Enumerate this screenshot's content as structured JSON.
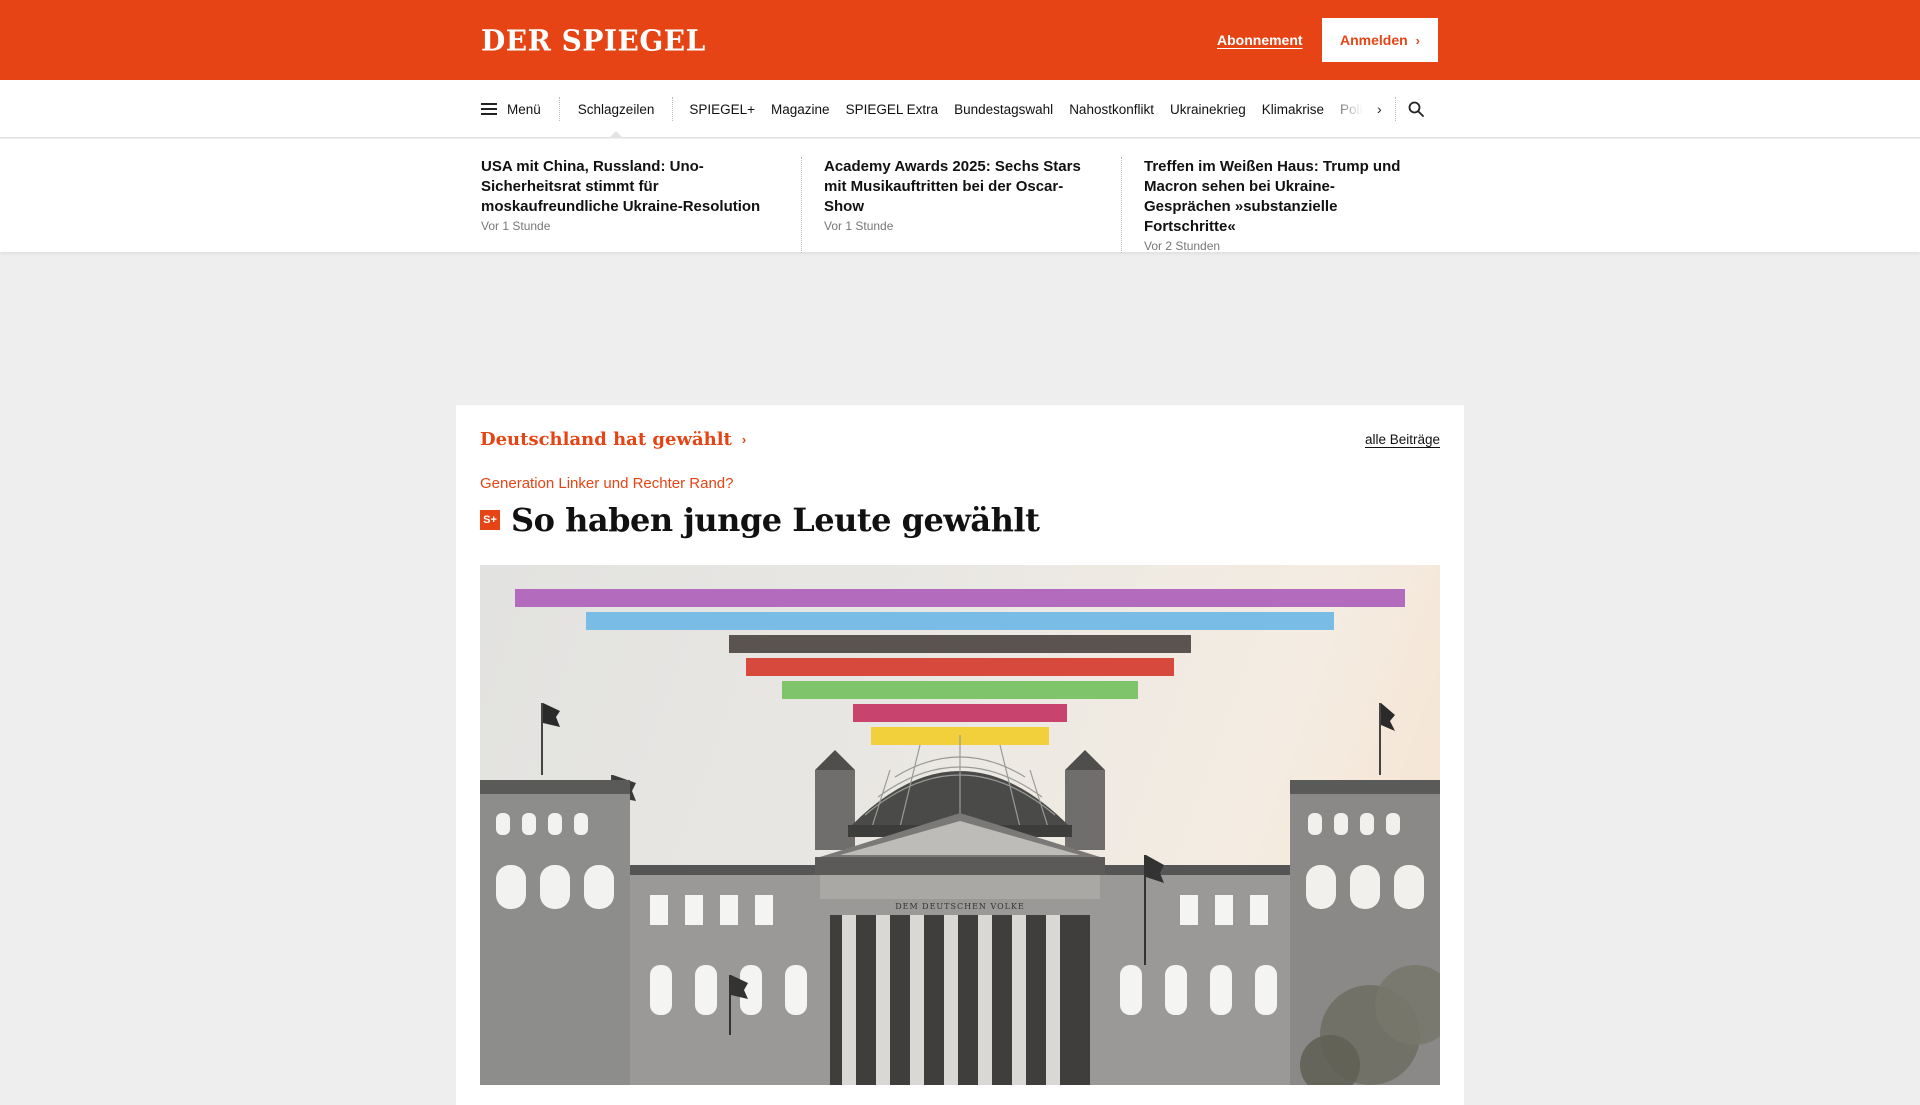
{
  "header": {
    "logo": "DER SPIEGEL",
    "subscription_link": "Abonnement",
    "login_button": "Anmelden",
    "brand_color": "#e64415"
  },
  "nav": {
    "menu_label": "Menü",
    "primary": "Schlagzeilen",
    "items": [
      "SPIEGEL+",
      "Magazine",
      "SPIEGEL Extra",
      "Bundestagswahl",
      "Nahostkonflikt",
      "Ukrainekrieg",
      "Klimakrise",
      "Politik"
    ],
    "next_icon": "chevron-right-icon",
    "search_icon": "search-icon"
  },
  "teasers": [
    {
      "title": "USA mit China, Russland: Uno-Sicherheitsrat stimmt für moskaufreundliche Ukraine-Resolution",
      "time": "Vor 1 Stunde"
    },
    {
      "title": "Academy Awards 2025: Sechs Stars mit Musikauftritten bei der Oscar-Show",
      "time": "Vor 1 Stunde"
    },
    {
      "title": "Treffen im Weißen Haus: Trump und Macron sehen bei Ukraine-Gesprächen »substanzielle Fortschritte«",
      "time": "Vor 2 Stunden"
    }
  ],
  "main": {
    "section_title": "Deutschland hat gewählt",
    "all_link": "alle Beiträge",
    "kicker": "Generation Linker und Rechter Rand?",
    "badge": "S+",
    "headline": "So haben junge Leute gewählt",
    "hero_image": {
      "inscription": "DEM DEUTSCHEN VOLKE",
      "bar_colors": [
        "#b36bbd",
        "#79bde6",
        "#5a5350",
        "#d8493d",
        "#7fc46a",
        "#c8436d",
        "#f1d03b"
      ]
    }
  }
}
